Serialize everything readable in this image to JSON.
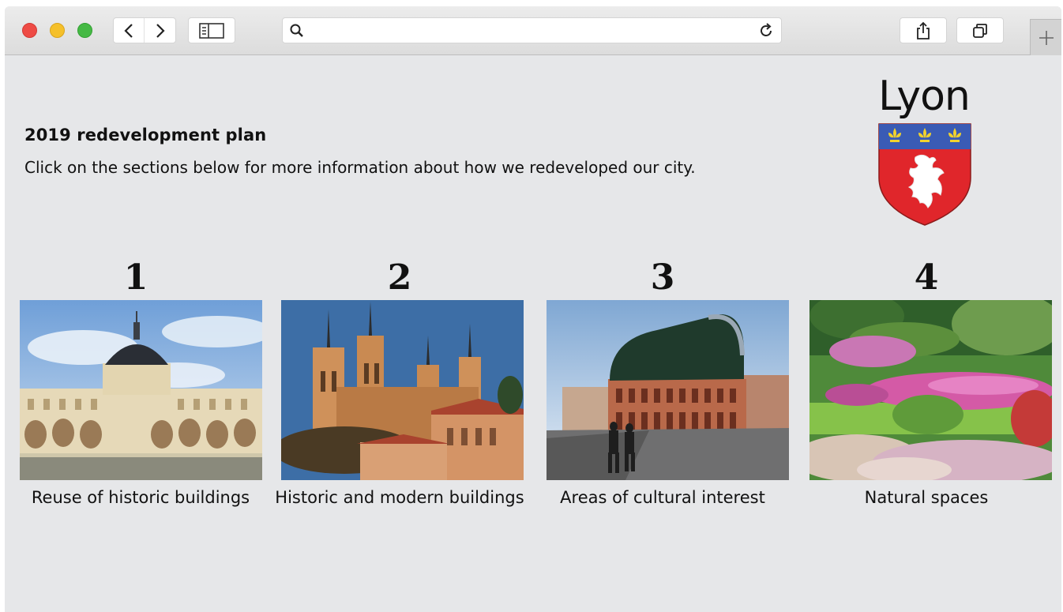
{
  "browser": {
    "address_value": "",
    "icons": [
      "back-icon",
      "forward-icon",
      "sidebar-icon",
      "search-icon",
      "reload-icon",
      "share-icon",
      "tabs-icon",
      "new-tab-icon"
    ]
  },
  "page": {
    "heading": "2019 redevelopment plan",
    "subtext": "Click on the sections below for more information about how we redeveloped our city.",
    "logo_text": "Lyon",
    "sections": [
      {
        "number": "1",
        "caption": "Reuse of historic buildings"
      },
      {
        "number": "2",
        "caption": "Historic and modern buildings"
      },
      {
        "number": "3",
        "caption": "Areas of cultural interest"
      },
      {
        "number": "4",
        "caption": "Natural spaces"
      }
    ]
  },
  "colors": {
    "crest_blue": "#3a5bb5",
    "crest_red": "#e0262b",
    "fleur_gold": "#f2d22e"
  }
}
